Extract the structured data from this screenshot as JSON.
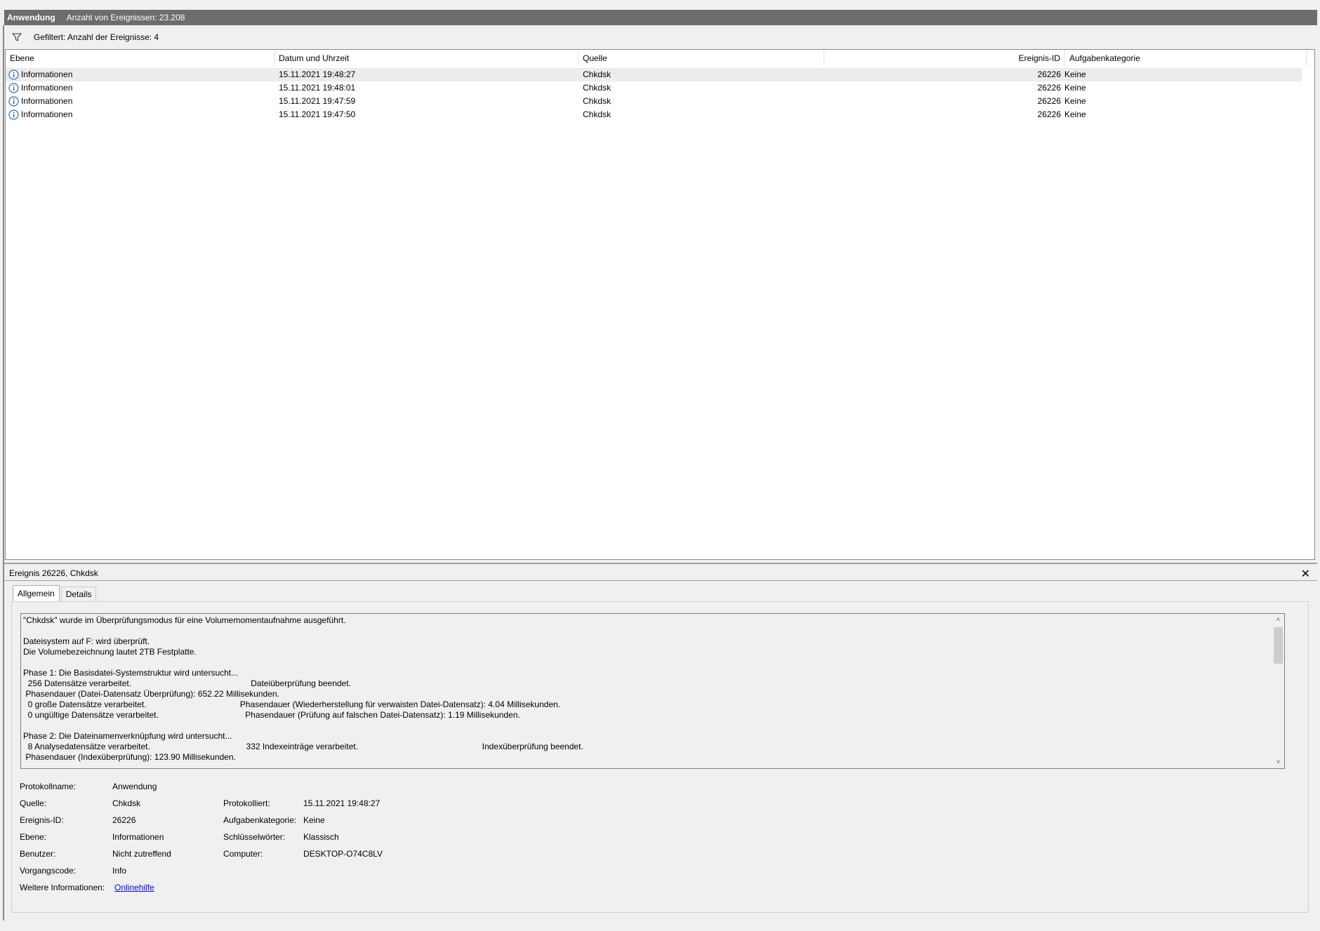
{
  "header": {
    "log_name": "Anwendung",
    "event_count": "Anzahl von Ereignissen: 23.208"
  },
  "filter": {
    "text": "Gefiltert: Anzahl der Ereignisse: 4"
  },
  "table": {
    "columns": {
      "level": "Ebene",
      "datetime": "Datum und Uhrzeit",
      "source": "Quelle",
      "event_id": "Ereignis-ID",
      "task_category": "Aufgabenkategorie"
    },
    "rows": [
      {
        "level": "Informationen",
        "datetime": "15.11.2021 19:48:27",
        "source": "Chkdsk",
        "event_id": "26226",
        "task_category": "Keine"
      },
      {
        "level": "Informationen",
        "datetime": "15.11.2021 19:48:01",
        "source": "Chkdsk",
        "event_id": "26226",
        "task_category": "Keine"
      },
      {
        "level": "Informationen",
        "datetime": "15.11.2021 19:47:59",
        "source": "Chkdsk",
        "event_id": "26226",
        "task_category": "Keine"
      },
      {
        "level": "Informationen",
        "datetime": "15.11.2021 19:47:50",
        "source": "Chkdsk",
        "event_id": "26226",
        "task_category": "Keine"
      }
    ]
  },
  "detail": {
    "title": "Ereignis 26226, Chkdsk",
    "tabs": [
      "Allgemein",
      "Details"
    ],
    "description": "\"Chkdsk\" wurde im Überprüfungsmodus für eine Volumemomentaufnahme ausgeführt.\n\nDateisystem auf F: wird überprüft.\nDie Volumebezeichnung lautet 2TB Festplatte.\n\nPhase 1: Die Basisdatei-Systemstruktur wird untersucht...\n  256 Datensätze verarbeitet.                                                   Dateiüberprüfung beendet.\n Phasendauer (Datei-Datensatz Überprüfung): 652.22 Millisekunden.\n  0 große Datensätze verarbeitet.                                        Phasendauer (Wiederherstellung für verwaisten Datei-Datensatz): 4.04 Millisekunden.\n  0 ungültige Datensätze verarbeitet.                                     Phasendauer (Prüfung auf falschen Datei-Datensatz): 1.19 Millisekunden.\n\nPhase 2: Die Dateinamenverknüpfung wird untersucht...\n  8 Analysedatensätze verarbeitet.                                         332 Indexeinträge verarbeitet.                                                     Indexüberprüfung beendet.\n Phasendauer (Indexüberprüfung): 123.90 Millisekunden.",
    "properties": {
      "protokollname_label": "Protokollname:",
      "protokollname": "Anwendung",
      "quelle_label": "Quelle:",
      "quelle": "Chkdsk",
      "protokolliert_label": "Protokolliert:",
      "protokolliert": "15.11.2021 19:48:27",
      "ereignis_id_label": "Ereignis-ID:",
      "ereignis_id": "26226",
      "aufgabenkategorie_label": "Aufgabenkategorie:",
      "aufgabenkategorie": "Keine",
      "ebene_label": "Ebene:",
      "ebene": "Informationen",
      "schluesselwoerter_label": "Schlüsselwörter:",
      "schluesselwoerter": "Klassisch",
      "benutzer_label": "Benutzer:",
      "benutzer": "Nicht zutreffend",
      "computer_label": "Computer:",
      "computer": "DESKTOP-O74C8LV",
      "vorgangscode_label": "Vorgangscode:",
      "vorgangscode": "Info",
      "weitere_label": "Weitere Informationen:",
      "weitere_link": "Onlinehilfe"
    }
  },
  "colors": {
    "titlebar": "#6d6d6d",
    "selected_row": "#ececec",
    "link": "#0000ff",
    "info_icon": "#2b6cc4"
  }
}
